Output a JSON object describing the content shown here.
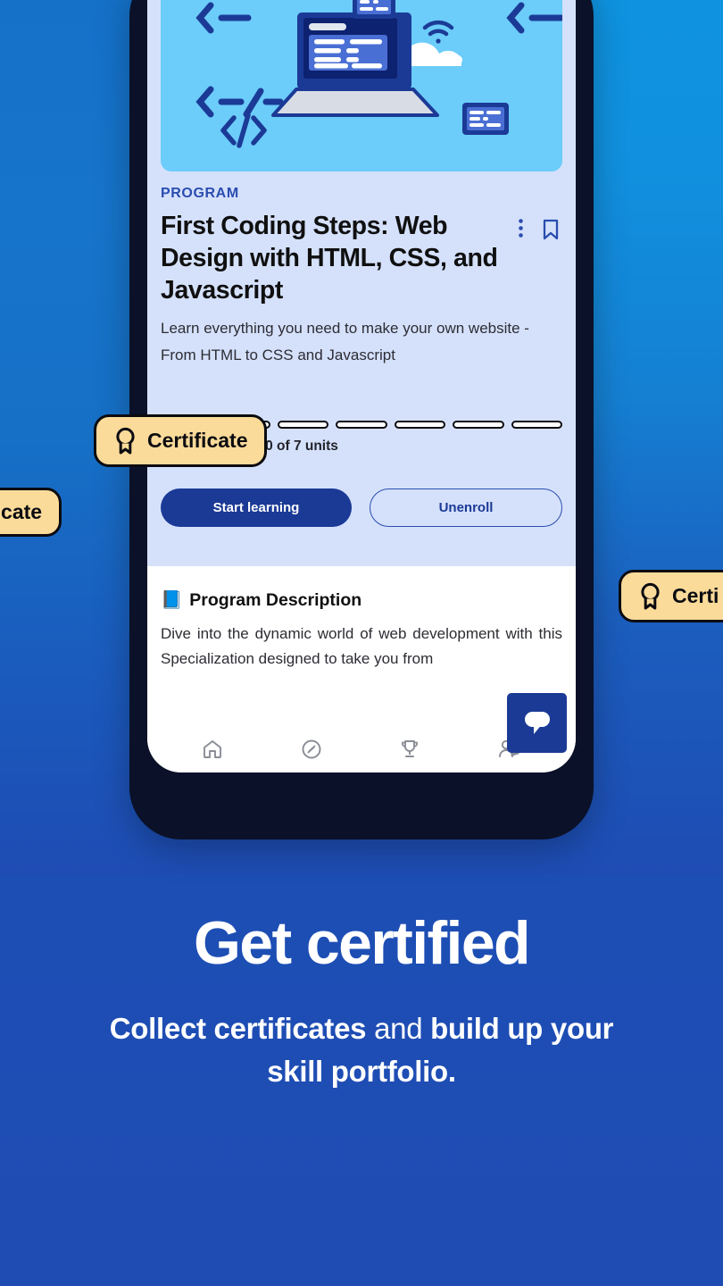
{
  "card": {
    "eyebrow": "PROGRAM",
    "title": "First Coding Steps: Web Design with HTML, CSS, and Javascript",
    "subtitle": "Learn everything you need to make your own website - From HTML to CSS and Javascript",
    "menu_icon": "three-dot-menu-icon",
    "bookmark_icon": "bookmark-icon",
    "hero_icon": "coding-laptop-illustration"
  },
  "progress": {
    "total_units": 7,
    "completed_units": 0,
    "segments": [
      false,
      false,
      false,
      false,
      false,
      false,
      false
    ],
    "label": "You've finished 0 of 7 units"
  },
  "actions": {
    "primary_label": "Start learning",
    "secondary_label": "Unenroll"
  },
  "description": {
    "icon": "closed-book-emoji",
    "emoji": "📘",
    "heading": "Program Description",
    "body": "Dive into the dynamic world of web development with this Specialization designed to take you from"
  },
  "nav": {
    "items": [
      {
        "name": "home",
        "icon": "home-icon"
      },
      {
        "name": "explore",
        "icon": "compass-icon"
      },
      {
        "name": "achievements",
        "icon": "trophy-icon"
      },
      {
        "name": "community",
        "icon": "people-icon"
      }
    ]
  },
  "chat": {
    "icon": "chat-bubble-icon",
    "label": "Chat"
  },
  "badges": {
    "main": "Certificate",
    "left_clipped": "rtificate",
    "right_clipped": "Certi",
    "icon": "award-medal-icon"
  },
  "footer": {
    "headline": "Get certified",
    "subhead_part1": "Collect certificates",
    "subhead_connector": " and ",
    "subhead_part2": "build up your skill portfolio",
    "subhead_period": "."
  },
  "colors": {
    "background_top": "#1478ce",
    "background_bottom": "#1e4cb3",
    "phone_bezel": "#0a1128",
    "card_surface": "#d5e1fb",
    "hero_surface": "#6cccfa",
    "accent_navy": "#1b3a96",
    "badge_yellow": "#fbdb9a",
    "badge_border": "#0b0b10"
  }
}
